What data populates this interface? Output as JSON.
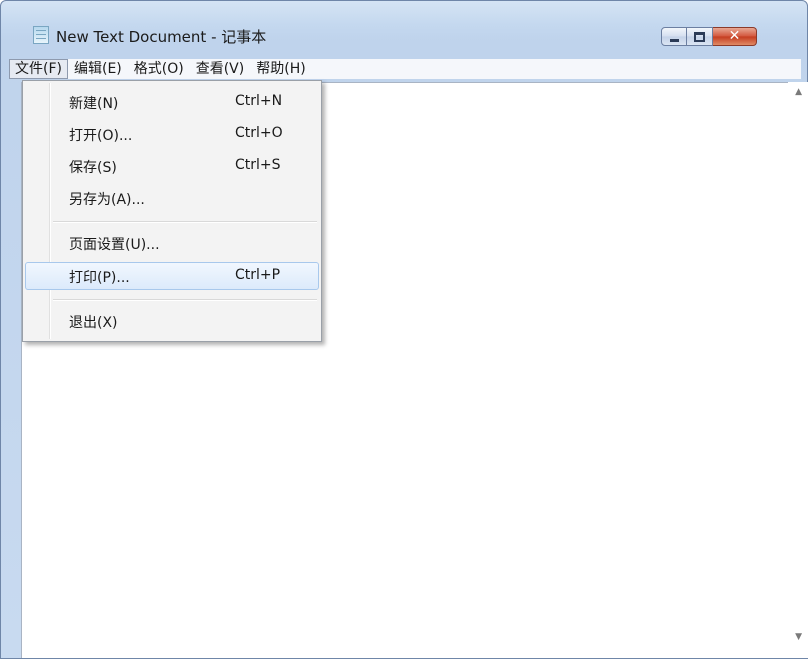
{
  "window": {
    "title": "New Text Document - 记事本",
    "close_glyph": "✕"
  },
  "menubar": {
    "items": [
      "文件(F)",
      "编辑(E)",
      "格式(O)",
      "查看(V)",
      "帮助(H)"
    ]
  },
  "file_menu": {
    "items": [
      {
        "label": "新建(N)",
        "shortcut": "Ctrl+N"
      },
      {
        "label": "打开(O)...",
        "shortcut": "Ctrl+O"
      },
      {
        "label": "保存(S)",
        "shortcut": "Ctrl+S"
      },
      {
        "label": "另存为(A)...",
        "shortcut": ""
      },
      {
        "label": "页面设置(U)...",
        "shortcut": ""
      },
      {
        "label": "打印(P)...",
        "shortcut": "Ctrl+P"
      },
      {
        "label": "退出(X)",
        "shortcut": ""
      }
    ],
    "highlighted": "打印(P)..."
  },
  "scrollbar": {
    "up_arrow": "▲",
    "down_arrow": "▼"
  }
}
